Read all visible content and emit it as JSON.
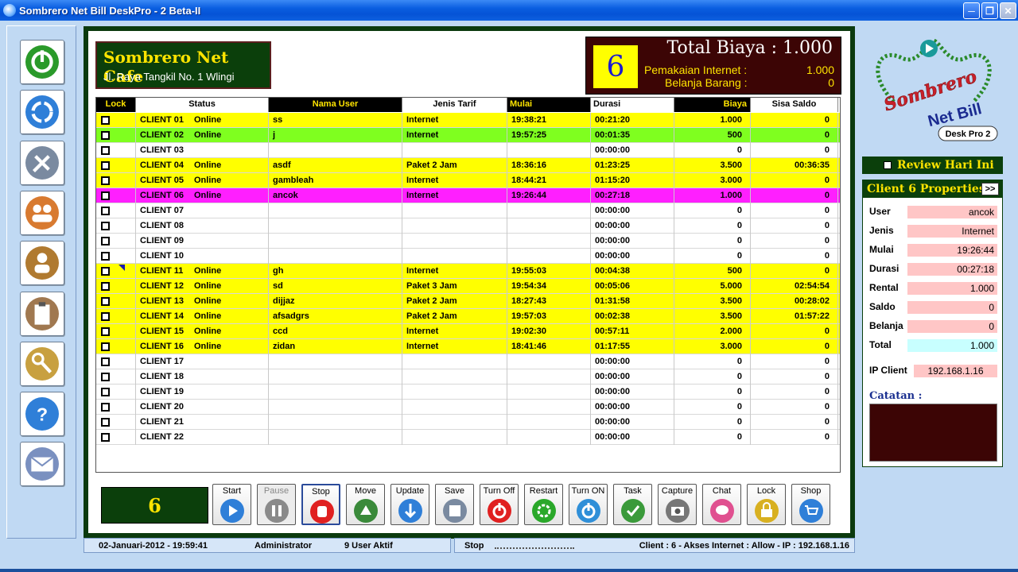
{
  "window": {
    "title": "Sombrero Net Bill DeskPro - 2 Beta-II"
  },
  "cafe": {
    "name": "Sombrero Net Cafe",
    "address": "Jl. Raya Tangkil No. 1 Wlingi"
  },
  "totals": {
    "client_number": "6",
    "total_label": "Total Biaya : 1.000",
    "internet_label": "Pemakaian Internet :",
    "internet_value": "1.000",
    "goods_label": "Belanja Barang :",
    "goods_value": "0"
  },
  "table": {
    "headers": [
      "Lock",
      "Status",
      "Nama User",
      "Jenis Tarif",
      "Mulai",
      "Durasi",
      "Biaya",
      "Sisa Saldo"
    ],
    "rows": [
      {
        "client": "CLIENT 01",
        "status": "Online",
        "user": "ss",
        "tarif": "Internet",
        "mulai": "19:38:21",
        "durasi": "00:21:20",
        "biaya": "1.000",
        "saldo": "0",
        "color": "#ffff00"
      },
      {
        "client": "CLIENT 02",
        "status": "Online",
        "user": "j",
        "tarif": "Internet",
        "mulai": "19:57:25",
        "durasi": "00:01:35",
        "biaya": "500",
        "saldo": "0",
        "color": "#7fff1f"
      },
      {
        "client": "CLIENT 03",
        "status": "",
        "user": "",
        "tarif": "",
        "mulai": "",
        "durasi": "00:00:00",
        "biaya": "0",
        "saldo": "0",
        "color": "#ffffff"
      },
      {
        "client": "CLIENT 04",
        "status": "Online",
        "user": "asdf",
        "tarif": "Paket 2 Jam",
        "mulai": "18:36:16",
        "durasi": "01:23:25",
        "biaya": "3.500",
        "saldo": "00:36:35",
        "color": "#ffff00"
      },
      {
        "client": "CLIENT 05",
        "status": "Online",
        "user": "gambleah",
        "tarif": "Internet",
        "mulai": "18:44:21",
        "durasi": "01:15:20",
        "biaya": "3.000",
        "saldo": "0",
        "color": "#ffff00"
      },
      {
        "client": "CLIENT 06",
        "status": "Online",
        "user": "ancok",
        "tarif": "Internet",
        "mulai": "19:26:44",
        "durasi": "00:27:18",
        "biaya": "1.000",
        "saldo": "0",
        "color": "#ff1fff"
      },
      {
        "client": "CLIENT 07",
        "status": "",
        "user": "",
        "tarif": "",
        "mulai": "",
        "durasi": "00:00:00",
        "biaya": "0",
        "saldo": "0",
        "color": "#ffffff"
      },
      {
        "client": "CLIENT 08",
        "status": "",
        "user": "",
        "tarif": "",
        "mulai": "",
        "durasi": "00:00:00",
        "biaya": "0",
        "saldo": "0",
        "color": "#ffffff"
      },
      {
        "client": "CLIENT 09",
        "status": "",
        "user": "",
        "tarif": "",
        "mulai": "",
        "durasi": "00:00:00",
        "biaya": "0",
        "saldo": "0",
        "color": "#ffffff"
      },
      {
        "client": "CLIENT 10",
        "status": "",
        "user": "",
        "tarif": "",
        "mulai": "",
        "durasi": "00:00:00",
        "biaya": "0",
        "saldo": "0",
        "color": "#ffffff"
      },
      {
        "client": "CLIENT 11",
        "status": "Online",
        "user": "gh",
        "tarif": "Internet",
        "mulai": "19:55:03",
        "durasi": "00:04:38",
        "biaya": "500",
        "saldo": "0",
        "color": "#ffff00"
      },
      {
        "client": "CLIENT 12",
        "status": "Online",
        "user": "sd",
        "tarif": "Paket 3 Jam",
        "mulai": "19:54:34",
        "durasi": "00:05:06",
        "biaya": "5.000",
        "saldo": "02:54:54",
        "color": "#ffff00"
      },
      {
        "client": "CLIENT 13",
        "status": "Online",
        "user": "dijjaz",
        "tarif": "Paket 2 Jam",
        "mulai": "18:27:43",
        "durasi": "01:31:58",
        "biaya": "3.500",
        "saldo": "00:28:02",
        "color": "#ffff00"
      },
      {
        "client": "CLIENT 14",
        "status": "Online",
        "user": "afsadgrs",
        "tarif": "Paket 2 Jam",
        "mulai": "19:57:03",
        "durasi": "00:02:38",
        "biaya": "3.500",
        "saldo": "01:57:22",
        "color": "#ffff00"
      },
      {
        "client": "CLIENT 15",
        "status": "Online",
        "user": "ccd",
        "tarif": "Internet",
        "mulai": "19:02:30",
        "durasi": "00:57:11",
        "biaya": "2.000",
        "saldo": "0",
        "color": "#ffff00"
      },
      {
        "client": "CLIENT 16",
        "status": "Online",
        "user": "zidan",
        "tarif": "Internet",
        "mulai": "18:41:46",
        "durasi": "01:17:55",
        "biaya": "3.000",
        "saldo": "0",
        "color": "#ffff00"
      },
      {
        "client": "CLIENT 17",
        "status": "",
        "user": "",
        "tarif": "",
        "mulai": "",
        "durasi": "00:00:00",
        "biaya": "0",
        "saldo": "0",
        "color": "#ffffff"
      },
      {
        "client": "CLIENT 18",
        "status": "",
        "user": "",
        "tarif": "",
        "mulai": "",
        "durasi": "00:00:00",
        "biaya": "0",
        "saldo": "0",
        "color": "#ffffff"
      },
      {
        "client": "CLIENT 19",
        "status": "",
        "user": "",
        "tarif": "",
        "mulai": "",
        "durasi": "00:00:00",
        "biaya": "0",
        "saldo": "0",
        "color": "#ffffff"
      },
      {
        "client": "CLIENT 20",
        "status": "",
        "user": "",
        "tarif": "",
        "mulai": "",
        "durasi": "00:00:00",
        "biaya": "0",
        "saldo": "0",
        "color": "#ffffff"
      },
      {
        "client": "CLIENT 21",
        "status": "",
        "user": "",
        "tarif": "",
        "mulai": "",
        "durasi": "00:00:00",
        "biaya": "0",
        "saldo": "0",
        "color": "#ffffff"
      },
      {
        "client": "CLIENT 22",
        "status": "",
        "user": "",
        "tarif": "",
        "mulai": "",
        "durasi": "00:00:00",
        "biaya": "0",
        "saldo": "0",
        "color": "#ffffff"
      }
    ]
  },
  "toolbar": {
    "counter": "6",
    "buttons": [
      {
        "label": "Start",
        "icon": "play-icon",
        "color": "#2f7fd8",
        "enabled": true
      },
      {
        "label": "Pause",
        "icon": "pause-icon",
        "color": "#8a8a8a",
        "enabled": false
      },
      {
        "label": "Stop",
        "icon": "stop-hand-icon",
        "color": "#e02020",
        "enabled": true
      },
      {
        "label": "Move",
        "icon": "move-icon",
        "color": "#3a8a3a",
        "enabled": true
      },
      {
        "label": "Update",
        "icon": "update-icon",
        "color": "#2f7fd8",
        "enabled": true
      },
      {
        "label": "Save",
        "icon": "save-icon",
        "color": "#7a8aa0",
        "enabled": true
      },
      {
        "label": "Turn Off",
        "icon": "power-off-icon",
        "color": "#e02020",
        "enabled": true
      },
      {
        "label": "Restart",
        "icon": "restart-icon",
        "color": "#2aa82a",
        "enabled": true
      },
      {
        "label": "Turn ON",
        "icon": "power-on-icon",
        "color": "#2f8fd8",
        "enabled": true
      },
      {
        "label": "Task",
        "icon": "task-icon",
        "color": "#3a9a3a",
        "enabled": true
      },
      {
        "label": "Capture",
        "icon": "camera-icon",
        "color": "#777777",
        "enabled": true
      },
      {
        "label": "Chat",
        "icon": "chat-icon",
        "color": "#e05090",
        "enabled": true
      },
      {
        "label": "Lock",
        "icon": "lock-icon",
        "color": "#d8b020",
        "enabled": true
      },
      {
        "label": "Shop",
        "icon": "shop-cart-icon",
        "color": "#2f7fd8",
        "enabled": true
      }
    ]
  },
  "sidebar": {
    "buttons": [
      {
        "name": "power-icon",
        "color": "#2a9a2a"
      },
      {
        "name": "refresh-icon",
        "color": "#2f7fd8"
      },
      {
        "name": "tools-icon",
        "color": "#7a8aa0"
      },
      {
        "name": "users-icon",
        "color": "#d87a30"
      },
      {
        "name": "admin-key-icon",
        "color": "#b07a30"
      },
      {
        "name": "clipboard-icon",
        "color": "#a07850"
      },
      {
        "name": "keys-icon",
        "color": "#c8a040"
      },
      {
        "name": "help-icon",
        "color": "#2f7fd8"
      },
      {
        "name": "mail-icon",
        "color": "#7a90c0"
      }
    ]
  },
  "logo": {
    "line1": "Sombrero",
    "line2": "Net Bill",
    "badge": "Desk Pro 2"
  },
  "review": {
    "label": "Review Hari Ini"
  },
  "properties": {
    "title": "Client 6 Properties",
    "expand": ">>",
    "fields": [
      {
        "label": "User",
        "value": "ancok"
      },
      {
        "label": "Jenis",
        "value": "Internet"
      },
      {
        "label": "Mulai",
        "value": "19:26:44"
      },
      {
        "label": "Durasi",
        "value": "00:27:18"
      },
      {
        "label": "Rental",
        "value": "1.000"
      },
      {
        "label": "Saldo",
        "value": "0"
      },
      {
        "label": "Belanja",
        "value": "0"
      },
      {
        "label": "Total",
        "value": "1.000"
      }
    ],
    "ip_label": "IP Client",
    "ip_value": "192.168.1.16",
    "notes_label": "Catatan :"
  },
  "status": {
    "datetime": "02-Januari-2012  -  19:59:41",
    "user": "Administrator",
    "active": "9 User Aktif",
    "state": "Stop",
    "info": "Client : 6 - Akses Internet : Allow - IP : 192.168.1.16"
  }
}
